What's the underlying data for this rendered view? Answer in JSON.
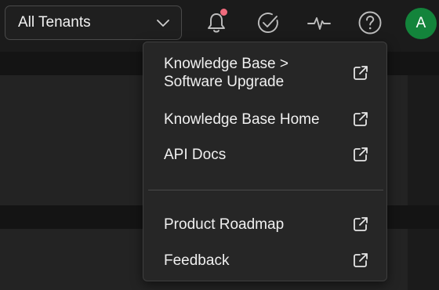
{
  "header": {
    "tenant_select": {
      "value": "All Tenants",
      "icon": "chevron-down-icon"
    },
    "icons": [
      {
        "name": "bell-icon",
        "has_notification_dot": true,
        "dot_color": "#f06b7d"
      },
      {
        "name": "check-circle-icon"
      },
      {
        "name": "activity-pulse-icon"
      },
      {
        "name": "help-circle-icon"
      }
    ],
    "avatar": {
      "initial": "A",
      "color": "#13843b"
    }
  },
  "menu": {
    "items": [
      {
        "label": "Knowledge Base >\nSoftware Upgrade",
        "icon": "external-link-icon"
      },
      {
        "label": "Knowledge Base Home",
        "icon": "external-link-icon"
      },
      {
        "label": "API Docs",
        "icon": "external-link-icon"
      },
      {
        "label": "Product Roadmap",
        "icon": "external-link-icon"
      },
      {
        "label": "Feedback",
        "icon": "external-link-icon"
      }
    ]
  },
  "colors": {
    "background": "#1b1b1b",
    "menu_background": "#262626",
    "text": "#f0f0f0"
  }
}
